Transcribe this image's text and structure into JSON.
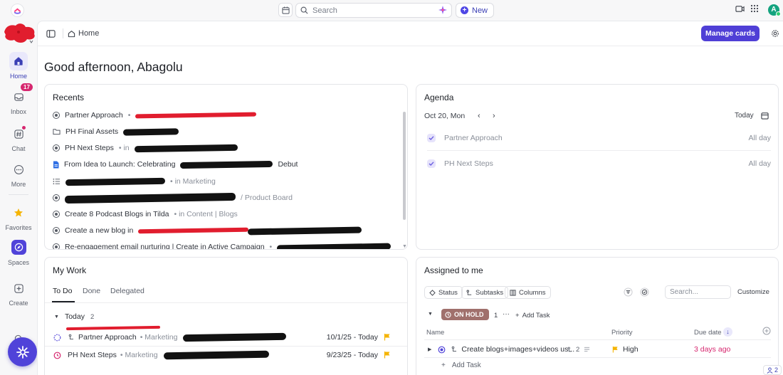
{
  "topbar": {
    "search_placeholder": "Search",
    "new_label": "New",
    "avatar_initial": "A"
  },
  "rail": {
    "items": [
      {
        "label": "Home"
      },
      {
        "label": "Inbox",
        "badge": "17"
      },
      {
        "label": "Chat"
      },
      {
        "label": "More"
      },
      {
        "label": "Favorites"
      },
      {
        "label": "Spaces"
      },
      {
        "label": "Create"
      }
    ]
  },
  "header": {
    "breadcrumb": "Home",
    "manage_cards": "Manage cards"
  },
  "greeting": "Good afternoon, Abagolu",
  "recents": {
    "title": "Recents",
    "items": [
      {
        "name": "Partner Approach",
        "suffix": "•"
      },
      {
        "name": "PH Final Assets",
        "suffix": ""
      },
      {
        "name": "PH Next Steps",
        "suffix": "• in"
      },
      {
        "name": "From Idea to Launch: Celebrating",
        "suffix": "Debut"
      },
      {
        "name": "",
        "suffix": "• in Marketing"
      },
      {
        "name": "",
        "suffix": "/ Product Board"
      },
      {
        "name": "Create 8 Podcast Blogs in Tilda",
        "suffix": "• in Content | Blogs"
      },
      {
        "name": "Create a new blog in",
        "suffix": ""
      },
      {
        "name": "Re-engagement email nurturing | Create in Active Campaign",
        "suffix": "•"
      }
    ]
  },
  "agenda": {
    "title": "Agenda",
    "date": "Oct 20, Mon",
    "prev": "‹",
    "next": "›",
    "today": "Today",
    "events": [
      {
        "name": "Partner Approach",
        "time": "All day"
      },
      {
        "name": "PH Next Steps",
        "time": "All day"
      }
    ]
  },
  "mywork": {
    "title": "My Work",
    "tabs": [
      "To Do",
      "Done",
      "Delegated"
    ],
    "group": "Today",
    "group_count": "2",
    "tasks": [
      {
        "name": "Partner Approach",
        "location": "• Marketing",
        "due": "10/1/25 - Today"
      },
      {
        "name": "PH Next Steps",
        "location": "• Marketing",
        "due": "9/23/25 - Today"
      }
    ]
  },
  "assigned": {
    "title": "Assigned to me",
    "chips": [
      "Status",
      "Subtasks",
      "Columns"
    ],
    "search_placeholder": "Search...",
    "customize": "Customize",
    "status": "ON HOLD",
    "status_count": "1",
    "ellipsis": "···",
    "add_task_header": "Add Task",
    "columns": [
      "Name",
      "Priority",
      "Due date"
    ],
    "row": {
      "name": "Create blogs+images+videos us...",
      "subtasks": "2",
      "priority": "High",
      "due": "3 days ago"
    },
    "add_task": "Add Task"
  },
  "footer": {
    "people_count": "2"
  },
  "colors": {
    "accent": "#4f3fd6",
    "onhold": "#a0706c",
    "overdue": "#d6276f",
    "flag": "#f5b400"
  }
}
